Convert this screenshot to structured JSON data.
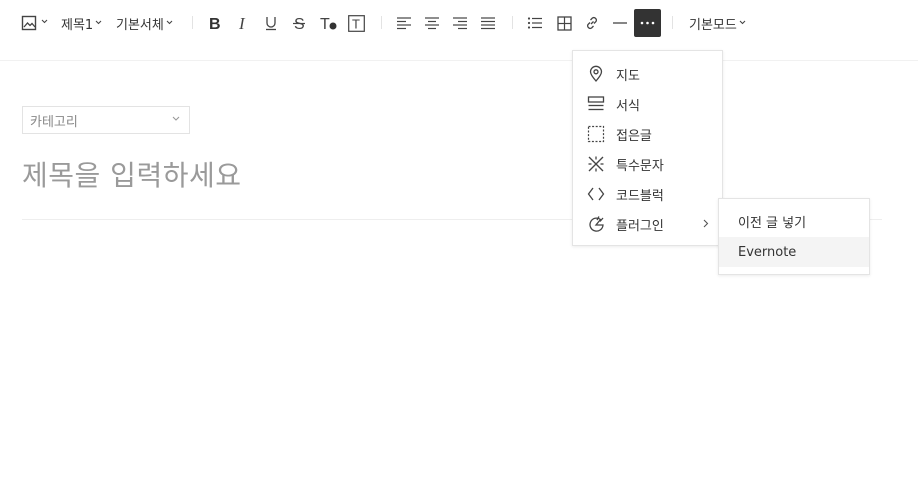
{
  "toolbar": {
    "heading_label": "제목1",
    "font_label": "기본서체",
    "mode_label": "기본모드"
  },
  "editor": {
    "category_label": "카테고리",
    "title_placeholder": "제목을 입력하세요"
  },
  "more_menu": {
    "items": [
      {
        "label": "지도",
        "icon": "map-pin-icon"
      },
      {
        "label": "서식",
        "icon": "template-icon"
      },
      {
        "label": "접은글",
        "icon": "fold-box-icon"
      },
      {
        "label": "특수문자",
        "icon": "special-char-icon"
      },
      {
        "label": "코드블럭",
        "icon": "code-icon"
      },
      {
        "label": "플러그인",
        "icon": "plugin-icon"
      }
    ]
  },
  "plugin_submenu": {
    "items": [
      {
        "label": "이전 글 넣기"
      },
      {
        "label": "Evernote"
      }
    ]
  },
  "colors": {
    "active_button": "#333333",
    "hover_row": "#f4f4f4"
  }
}
